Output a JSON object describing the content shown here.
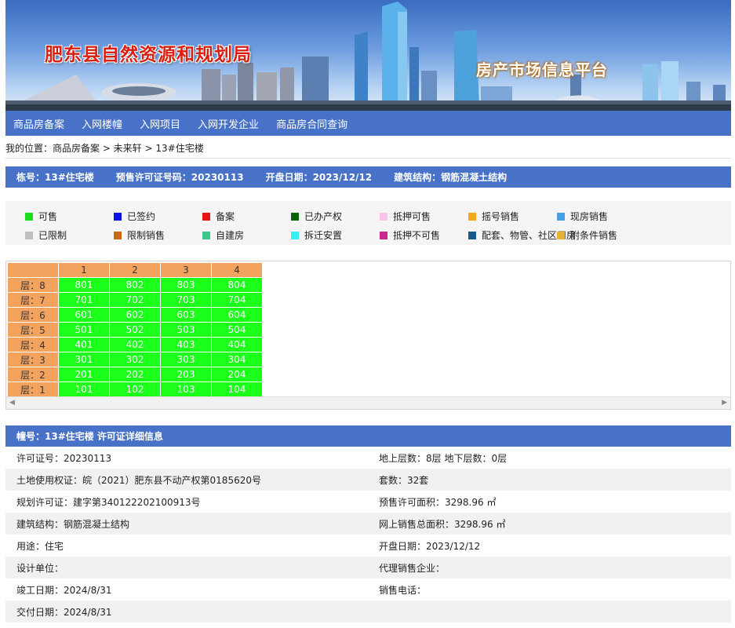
{
  "banner": {
    "title": "肥东县自然资源和规划局",
    "subtitle": "房产市场信息平台"
  },
  "nav": {
    "items": [
      "商品房备案",
      "入网楼幢",
      "入网项目",
      "入网开发企业",
      "商品房合同查询"
    ]
  },
  "breadcrumb": "我的位置：商品房备案 > 未来轩 > 13#住宅楼",
  "info": {
    "building": "栋号：13#住宅楼",
    "permit": "预售许可证号码：20230113",
    "open_date": "开盘日期：2023/12/12",
    "structure": "建筑结构：钢筋混凝土结构"
  },
  "legend": [
    {
      "label": "可售",
      "color": "#1bdc1b"
    },
    {
      "label": "已签约",
      "color": "#0a14e6"
    },
    {
      "label": "备案",
      "color": "#e81414"
    },
    {
      "label": "已办产权",
      "color": "#0a640a"
    },
    {
      "label": "抵押可售",
      "color": "#ffc2ea"
    },
    {
      "label": "摇号销售",
      "color": "#f5a51e"
    },
    {
      "label": "现房销售",
      "color": "#46a0e6"
    },
    {
      "label": "已限制",
      "color": "#bfbfbf"
    },
    {
      "label": "限制销售",
      "color": "#c8690f"
    },
    {
      "label": "自建房",
      "color": "#3cc88c"
    },
    {
      "label": "拆迁安置",
      "color": "#32f0f0"
    },
    {
      "label": "抵押不可售",
      "color": "#c8288c"
    },
    {
      "label": "配套、物管、社区用房",
      "color": "#145a8c"
    },
    {
      "label": "附条件销售",
      "color": "#e6b432"
    }
  ],
  "grid": {
    "columns": [
      "1",
      "2",
      "3",
      "4"
    ],
    "rows": [
      {
        "floor": "层：8",
        "units": [
          "801",
          "802",
          "803",
          "804"
        ]
      },
      {
        "floor": "层：7",
        "units": [
          "701",
          "702",
          "703",
          "704"
        ]
      },
      {
        "floor": "层：6",
        "units": [
          "601",
          "602",
          "603",
          "604"
        ]
      },
      {
        "floor": "层：5",
        "units": [
          "501",
          "502",
          "503",
          "504"
        ]
      },
      {
        "floor": "层：4",
        "units": [
          "401",
          "402",
          "403",
          "404"
        ]
      },
      {
        "floor": "层：3",
        "units": [
          "301",
          "302",
          "303",
          "304"
        ]
      },
      {
        "floor": "层：2",
        "units": [
          "201",
          "202",
          "203",
          "204"
        ]
      },
      {
        "floor": "层：1",
        "units": [
          "101",
          "102",
          "103",
          "104"
        ]
      }
    ]
  },
  "details": {
    "header": "幢号：13#住宅楼 许可证详细信息",
    "rows": [
      {
        "left": "许可证号：20230113",
        "right": "地上层数：8层  地下层数：0层"
      },
      {
        "left": "土地使用权证：皖（2021）肥东县不动产权第0185620号",
        "right": "套数：32套"
      },
      {
        "left": "规划许可证：建字第340122202100913号",
        "right": "预售许可面积：3298.96 ㎡"
      },
      {
        "left": "建筑结构：钢筋混凝土结构",
        "right": "网上销售总面积：3298.96 ㎡"
      },
      {
        "left": "用途：住宅",
        "right": "开盘日期：2023/12/12"
      },
      {
        "left": "设计单位：",
        "right": "代理销售企业："
      },
      {
        "left": "竣工日期：2024/8/31",
        "right": "销售电话："
      },
      {
        "left": "交付日期：2024/8/31",
        "right": ""
      }
    ]
  }
}
